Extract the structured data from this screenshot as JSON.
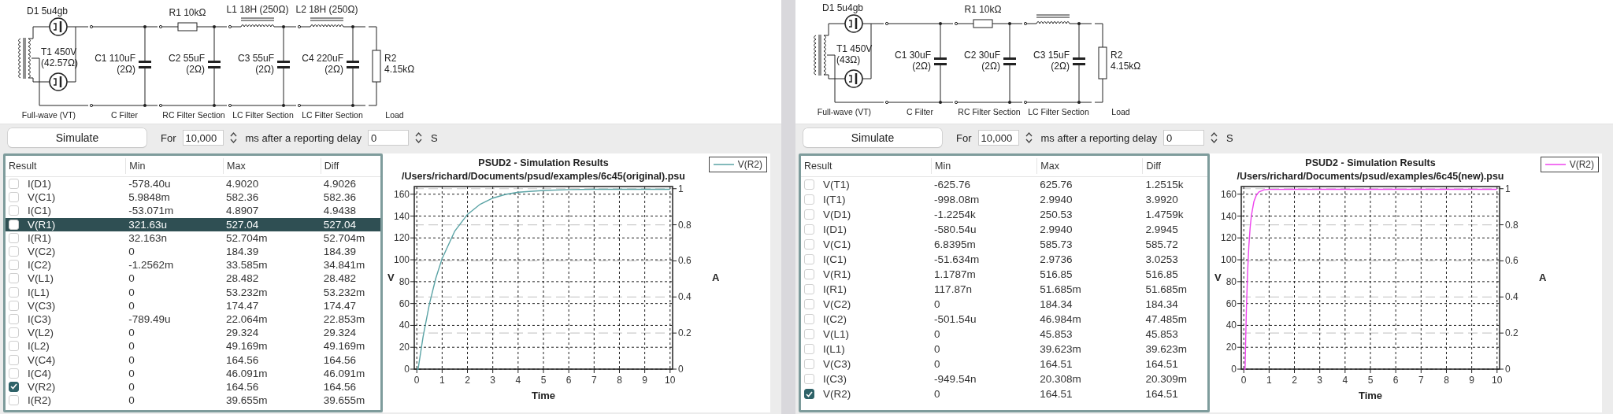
{
  "windows": [
    {
      "schematic": {
        "sections": [
          {
            "kind": "rectifier",
            "label": "Full-wave (VT)",
            "diode": "D1 5u4gb",
            "transformer": [
              "T1 450V",
              "(42.57Ω)"
            ]
          },
          {
            "kind": "c_filter",
            "label": "C Filter",
            "cap": [
              "C1 110uF",
              "(2Ω)"
            ]
          },
          {
            "kind": "rc_filter",
            "label": "RC Filter Section",
            "series": "R1 10kΩ",
            "cap": [
              "C2 55uF",
              "(2Ω)"
            ]
          },
          {
            "kind": "lc_filter",
            "label": "LC Filter Section",
            "series": "L1 18H (250Ω)",
            "cap": [
              "C3 55uF",
              "(2Ω)"
            ]
          },
          {
            "kind": "lc_filter",
            "label": "LC Filter Section",
            "series": "L2 18H (250Ω)",
            "cap": [
              "C4 220uF",
              "(2Ω)"
            ]
          },
          {
            "kind": "load",
            "label": "Load",
            "load": [
              "R2",
              "4.15kΩ"
            ]
          }
        ]
      },
      "toolbar": {
        "button": "Simulate",
        "for_label": "For",
        "duration": "10,000",
        "duration_unit": "ms after a reporting delay",
        "delay": "0",
        "delay_unit": "S"
      },
      "results": {
        "columns": [
          "Result",
          "Min",
          "Max",
          "Diff"
        ],
        "rows": [
          {
            "name": "I(D1)",
            "min": "-578.40u",
            "max": "4.9020",
            "diff": "4.9026",
            "checked": false,
            "selected": false
          },
          {
            "name": "V(C1)",
            "min": "5.9848m",
            "max": "582.36",
            "diff": "582.36",
            "checked": false,
            "selected": false
          },
          {
            "name": "I(C1)",
            "min": "-53.071m",
            "max": "4.8907",
            "diff": "4.9438",
            "checked": false,
            "selected": false
          },
          {
            "name": "V(R1)",
            "min": "321.63u",
            "max": "527.04",
            "diff": "527.04",
            "checked": false,
            "selected": true
          },
          {
            "name": "I(R1)",
            "min": "32.163n",
            "max": "52.704m",
            "diff": "52.704m",
            "checked": false,
            "selected": false
          },
          {
            "name": "V(C2)",
            "min": "0",
            "max": "184.39",
            "diff": "184.39",
            "checked": false,
            "selected": false
          },
          {
            "name": "I(C2)",
            "min": "-1.2562m",
            "max": "33.585m",
            "diff": "34.841m",
            "checked": false,
            "selected": false
          },
          {
            "name": "V(L1)",
            "min": "0",
            "max": "28.482",
            "diff": "28.482",
            "checked": false,
            "selected": false
          },
          {
            "name": "I(L1)",
            "min": "0",
            "max": "53.232m",
            "diff": "53.232m",
            "checked": false,
            "selected": false
          },
          {
            "name": "V(C3)",
            "min": "0",
            "max": "174.47",
            "diff": "174.47",
            "checked": false,
            "selected": false
          },
          {
            "name": "I(C3)",
            "min": "-789.49u",
            "max": "22.064m",
            "diff": "22.853m",
            "checked": false,
            "selected": false
          },
          {
            "name": "V(L2)",
            "min": "0",
            "max": "29.324",
            "diff": "29.324",
            "checked": false,
            "selected": false
          },
          {
            "name": "I(L2)",
            "min": "0",
            "max": "49.169m",
            "diff": "49.169m",
            "checked": false,
            "selected": false
          },
          {
            "name": "V(C4)",
            "min": "0",
            "max": "164.56",
            "diff": "164.56",
            "checked": false,
            "selected": false
          },
          {
            "name": "I(C4)",
            "min": "0",
            "max": "46.091m",
            "diff": "46.091m",
            "checked": false,
            "selected": false
          },
          {
            "name": "V(R2)",
            "min": "0",
            "max": "164.56",
            "diff": "164.56",
            "checked": true,
            "selected": false
          },
          {
            "name": "I(R2)",
            "min": "0",
            "max": "39.655m",
            "diff": "39.655m",
            "checked": false,
            "selected": false
          }
        ]
      },
      "chart": {
        "subtitle": "/Users/richard/Documents/psud/examples/6c45(original).psu",
        "right_axis": {
          "label": "A",
          "ticks": [
            "1",
            "0.8",
            "0.6",
            "0.4",
            "0.2",
            "0"
          ]
        },
        "chart_data": {
          "type": "line",
          "grid": true,
          "title": "PSUD2 - Simulation Results",
          "xlabel": "Time",
          "ylabel": "V",
          "x": [
            0,
            0.05,
            0.25,
            0.5,
            0.75,
            1,
            1.5,
            2,
            2.5,
            3,
            3.5,
            4,
            5,
            6,
            7,
            8,
            9,
            10
          ],
          "series": [
            {
              "name": "V(R2)",
              "color": "#5aa3a5",
              "values": [
                0,
                0,
                29.9,
                59.8,
                83.1,
                101.2,
                126.3,
                141.5,
                150.8,
                156.4,
                159.8,
                161.8,
                163.4,
                164.2,
                164.5,
                164.5,
                164.5,
                164.5
              ]
            }
          ],
          "xlim": [
            -0.1,
            10.1
          ],
          "ylim": [
            0,
            167
          ],
          "xticks": [
            0,
            1,
            2,
            3,
            4,
            5,
            6,
            7,
            8,
            9,
            10
          ],
          "yticks": [
            0,
            20,
            40,
            60,
            80,
            100,
            120,
            140,
            160
          ]
        }
      }
    },
    {
      "schematic": {
        "sections": [
          {
            "kind": "rectifier",
            "label": "Full-wave (VT)",
            "diode": "D1 5u4gb",
            "transformer": [
              "T1 450V",
              "(43Ω)"
            ]
          },
          {
            "kind": "c_filter",
            "label": "C Filter",
            "cap": [
              "C1 30uF",
              "(2Ω)"
            ]
          },
          {
            "kind": "rc_filter",
            "label": "RC Filter Section",
            "series": "R1 10kΩ",
            "cap": [
              "C2 30uF",
              "(2Ω)"
            ]
          },
          {
            "kind": "lc_filter",
            "label": "LC Filter Section",
            "cap": [
              "C3 15uF",
              "(2Ω)"
            ]
          },
          {
            "kind": "load",
            "label": "Load",
            "load": [
              "R2",
              "4.15kΩ"
            ]
          }
        ]
      },
      "toolbar": {
        "button": "Simulate",
        "for_label": "For",
        "duration": "10,000",
        "duration_unit": "ms after a reporting delay",
        "delay": "0",
        "delay_unit": "S"
      },
      "results": {
        "columns": [
          "Result",
          "Min",
          "Max",
          "Diff"
        ],
        "rows": [
          {
            "name": "V(T1)",
            "min": "-625.76",
            "max": "625.76",
            "diff": "1.2515k",
            "checked": false,
            "selected": false
          },
          {
            "name": "I(T1)",
            "min": "-998.08m",
            "max": "2.9940",
            "diff": "3.9920",
            "checked": false,
            "selected": false
          },
          {
            "name": "V(D1)",
            "min": "-1.2254k",
            "max": "250.53",
            "diff": "1.4759k",
            "checked": false,
            "selected": false
          },
          {
            "name": "I(D1)",
            "min": "-580.54u",
            "max": "2.9940",
            "diff": "2.9945",
            "checked": false,
            "selected": false
          },
          {
            "name": "V(C1)",
            "min": "6.8395m",
            "max": "585.73",
            "diff": "585.72",
            "checked": false,
            "selected": false
          },
          {
            "name": "I(C1)",
            "min": "-51.634m",
            "max": "2.9736",
            "diff": "3.0253",
            "checked": false,
            "selected": false
          },
          {
            "name": "V(R1)",
            "min": "1.1787m",
            "max": "516.85",
            "diff": "516.85",
            "checked": false,
            "selected": false
          },
          {
            "name": "I(R1)",
            "min": "117.87n",
            "max": "51.685m",
            "diff": "51.685m",
            "checked": false,
            "selected": false
          },
          {
            "name": "V(C2)",
            "min": "0",
            "max": "184.34",
            "diff": "184.34",
            "checked": false,
            "selected": false
          },
          {
            "name": "I(C2)",
            "min": "-501.54u",
            "max": "46.984m",
            "diff": "47.485m",
            "checked": false,
            "selected": false
          },
          {
            "name": "V(L1)",
            "min": "0",
            "max": "45.853",
            "diff": "45.853",
            "checked": false,
            "selected": false
          },
          {
            "name": "I(L1)",
            "min": "0",
            "max": "39.623m",
            "diff": "39.623m",
            "checked": false,
            "selected": false
          },
          {
            "name": "V(C3)",
            "min": "0",
            "max": "164.51",
            "diff": "164.51",
            "checked": false,
            "selected": false
          },
          {
            "name": "I(C3)",
            "min": "-949.54n",
            "max": "20.308m",
            "diff": "20.309m",
            "checked": false,
            "selected": false
          },
          {
            "name": "V(R2)",
            "min": "0",
            "max": "164.51",
            "diff": "164.51",
            "checked": true,
            "selected": false
          }
        ]
      },
      "chart": {
        "subtitle": "/Users/richard/Documents/psud/examples/6c45(new).psu",
        "right_axis": {
          "label": "A",
          "ticks": [
            "1",
            "0.8",
            "0.6",
            "0.4",
            "0.2",
            "0"
          ]
        },
        "chart_data": {
          "type": "line",
          "grid": true,
          "title": "PSUD2 - Simulation Results",
          "xlabel": "Time",
          "ylabel": "V",
          "x": [
            0,
            0.05,
            0.1,
            0.15,
            0.2,
            0.25,
            0.3,
            0.4,
            0.5,
            0.6,
            0.8,
            1,
            2,
            3,
            4,
            5,
            6,
            7,
            8,
            9,
            10
          ],
          "series": [
            {
              "name": "V(R2)",
              "color": "#ee44ee",
              "values": [
                0,
                0,
                52.5,
                88.3,
                112.6,
                129.2,
                140.5,
                153.3,
                159.3,
                162.1,
                164.0,
                164.4,
                164.5,
                164.5,
                164.5,
                164.5,
                164.5,
                164.5,
                164.5,
                164.5,
                164.5
              ]
            }
          ],
          "xlim": [
            -0.1,
            10.1
          ],
          "ylim": [
            0,
            167
          ],
          "xticks": [
            0,
            1,
            2,
            3,
            4,
            5,
            6,
            7,
            8,
            9,
            10
          ],
          "yticks": [
            0,
            20,
            40,
            60,
            80,
            100,
            120,
            140,
            160
          ]
        }
      }
    }
  ]
}
